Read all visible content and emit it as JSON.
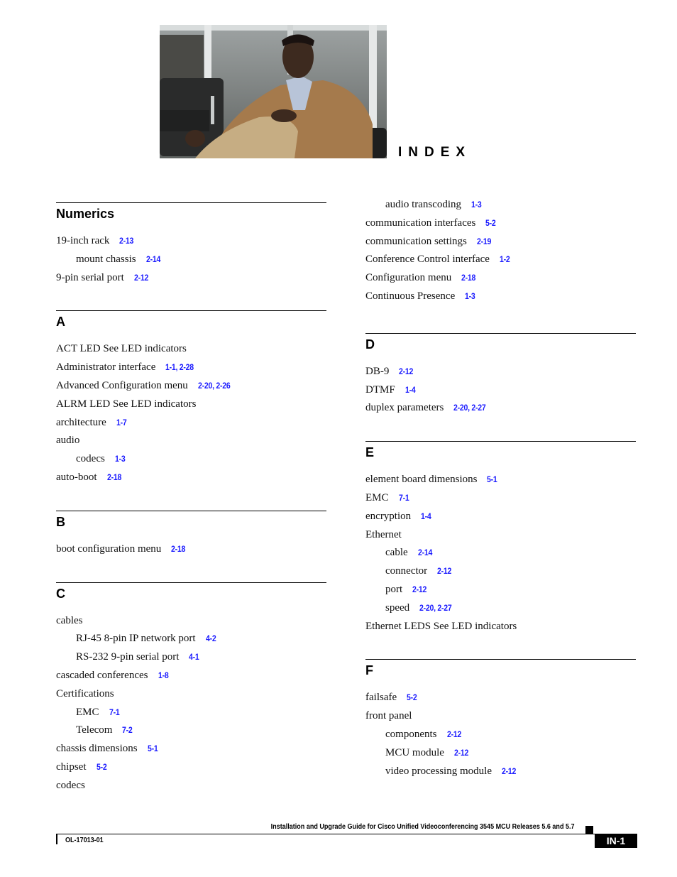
{
  "header": {
    "photo_alt": "man in tan jacket seated on black leather couch",
    "title": "INDEX"
  },
  "left_column": {
    "sections": [
      {
        "heading": "Numerics",
        "entries": [
          {
            "term": "19-inch rack",
            "refs": "2-13",
            "level": 1
          },
          {
            "term": "mount chassis",
            "refs": "2-14",
            "level": 2
          },
          {
            "term": "9-pin serial port",
            "refs": "2-12",
            "level": 1
          }
        ]
      },
      {
        "heading": "A",
        "entries": [
          {
            "term": "ACT LED See LED indicators",
            "refs": "",
            "level": 1
          },
          {
            "term": "Administrator interface",
            "refs": "1-1, 2-28",
            "level": 1
          },
          {
            "term": "Advanced Configuration menu",
            "refs": "2-20, 2-26",
            "level": 1
          },
          {
            "term": "ALRM LED See LED indicators",
            "refs": "",
            "level": 1
          },
          {
            "term": "architecture",
            "refs": "1-7",
            "level": 1
          },
          {
            "term": "audio",
            "refs": "",
            "level": 1
          },
          {
            "term": "codecs",
            "refs": "1-3",
            "level": 2
          },
          {
            "term": "auto-boot",
            "refs": "2-18",
            "level": 1
          }
        ]
      },
      {
        "heading": "B",
        "entries": [
          {
            "term": "boot configuration menu",
            "refs": "2-18",
            "level": 1
          }
        ]
      },
      {
        "heading": "C",
        "entries": [
          {
            "term": "cables",
            "refs": "",
            "level": 1
          },
          {
            "term": "RJ-45 8-pin IP network port",
            "refs": "4-2",
            "level": 2
          },
          {
            "term": "RS-232 9-pin serial port",
            "refs": "4-1",
            "level": 2
          },
          {
            "term": "cascaded conferences",
            "refs": "1-8",
            "level": 1
          },
          {
            "term": "Certifications",
            "refs": "",
            "level": 1
          },
          {
            "term": "EMC",
            "refs": "7-1",
            "level": 2
          },
          {
            "term": "Telecom",
            "refs": "7-2",
            "level": 2
          },
          {
            "term": "chassis dimensions",
            "refs": "5-1",
            "level": 1
          },
          {
            "term": "chipset",
            "refs": "5-2",
            "level": 1
          },
          {
            "term": "codecs",
            "refs": "",
            "level": 1
          }
        ]
      }
    ]
  },
  "right_column": {
    "continued_entries": [
      {
        "term": "audio transcoding",
        "refs": "1-3",
        "level": 2
      },
      {
        "term": "communication interfaces",
        "refs": "5-2",
        "level": 1
      },
      {
        "term": "communication settings",
        "refs": "2-19",
        "level": 1
      },
      {
        "term": "Conference Control interface",
        "refs": "1-2",
        "level": 1
      },
      {
        "term": "Configuration menu",
        "refs": "2-18",
        "level": 1
      },
      {
        "term": "Continuous Presence",
        "refs": "1-3",
        "level": 1
      }
    ],
    "sections": [
      {
        "heading": "D",
        "entries": [
          {
            "term": "DB-9",
            "refs": "2-12",
            "level": 1
          },
          {
            "term": "DTMF",
            "refs": "1-4",
            "level": 1
          },
          {
            "term": "duplex parameters",
            "refs": "2-20, 2-27",
            "level": 1
          }
        ]
      },
      {
        "heading": "E",
        "entries": [
          {
            "term": "element board dimensions",
            "refs": "5-1",
            "level": 1
          },
          {
            "term": "EMC",
            "refs": "7-1",
            "level": 1
          },
          {
            "term": "encryption",
            "refs": "1-4",
            "level": 1
          },
          {
            "term": "Ethernet",
            "refs": "",
            "level": 1
          },
          {
            "term": "cable",
            "refs": "2-14",
            "level": 2
          },
          {
            "term": "connector",
            "refs": "2-12",
            "level": 2
          },
          {
            "term": "port",
            "refs": "2-12",
            "level": 2
          },
          {
            "term": "speed",
            "refs": "2-20, 2-27",
            "level": 2
          },
          {
            "term": "Ethernet LEDS See LED indicators",
            "refs": "",
            "level": 1
          }
        ]
      },
      {
        "heading": "F",
        "entries": [
          {
            "term": "failsafe",
            "refs": "5-2",
            "level": 1
          },
          {
            "term": "front panel",
            "refs": "",
            "level": 1
          },
          {
            "term": "components",
            "refs": "2-12",
            "level": 2
          },
          {
            "term": "MCU module",
            "refs": "2-12",
            "level": 2
          },
          {
            "term": "video processing module",
            "refs": "2-12",
            "level": 2
          }
        ]
      }
    ]
  },
  "footer": {
    "guide_title": "Installation and Upgrade Guide for Cisco Unified Videoconferencing 3545 MCU Releases 5.6 and 5.7",
    "doc_number": "OL-17013-01",
    "page_label": "IN-1"
  },
  "colors": {
    "link": "#1a1aff",
    "text": "#111111",
    "rule": "#000000"
  }
}
